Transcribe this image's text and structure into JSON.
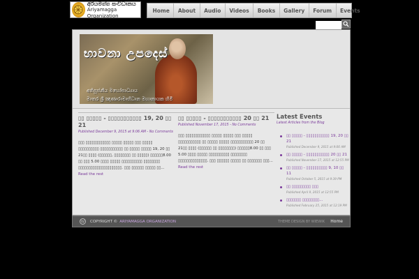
{
  "header": {
    "logo_line1": "අරියමග්ග සංවිධානය",
    "logo_line2": "Ariyamagga Organization",
    "nav": [
      "Home",
      "About",
      "Audio",
      "Videos",
      "Books",
      "Gallery",
      "Forum",
      "Events"
    ],
    "search_placeholder": ""
  },
  "banner": {
    "title": "භාවනා උපදෙස්",
    "subtitle_line1": "අතිපූජනීය මහෝපාධ්‍යාය",
    "subtitle_line2": "මාතර ශ්‍රී ඤාණාරාමාභිධාන මහානායක හිමි"
  },
  "posts": [
    {
      "title": "▯▯ ▯▯▯▯▯ - ▯▯▯▯▯▯▯▯▯▯▯ 19, 20 ▯▯ 21",
      "meta": "Published December 9, 2015 at 9:06 AM - No Comments",
      "body": "▯▯▯ ▯▯▯▯▯▯▯▯▯▯▯▯ ▯▯▯▯▯ ▯▯▯▯▯ ▯▯▯ ▯▯▯▯▯ ▯▯▯▯▯▯▯▯▯▯ ▯▯▯▯▯▯▯▯▯▯▯ ▯▯ ▯▯▯▯▯ ▯▯▯▯▯ 19, 20 ▯▯ 21▯▯ ▯▯▯▯ (▯▯▯▯▯▯, ▯▯▯▯▯▯▯▯ ▯▯ ▯▯▯▯▯) ▯▯▯▯▯▯8.00 ▯▯ ▯▯▯ 5.00 ▯▯▯▯ ▯▯▯▯▯ ▯▯▯▯▯▯▯▯▯▯ ▯▯▯▯▯▯▯▯ ▯▯▯▯▯▯▯▯▯▯▯▯▯▯▯▯▯▯▯▯▯. ▯▯▯ ▯▯▯▯▯▯ ▯▯▯▯▯ ▯▯...",
      "readmore": "Read the rest"
    },
    {
      "title": "▯▯ ▯▯▯▯▯ - ▯▯▯▯▯▯▯▯▯▯▯ 20 ▯▯ 21",
      "meta": "Published November 17, 2015 - No Comments",
      "body": "▯▯▯ ▯▯▯▯▯▯▯▯▯▯▯▯ ▯▯▯▯▯ ▯▯▯▯▯ ▯▯▯ ▯▯▯▯▯ ▯▯▯▯▯▯▯▯▯▯▯ ▯▯ ▯▯▯▯▯ ▯▯▯▯▯ ▯▯▯▯▯▯▯▯▯▯▯ 20 ▯▯ 21▯▯ ▯▯▯▯ (▯▯▯▯▯▯ ▯▯ ▯▯▯▯▯▯▯▯) ▯▯▯▯▯▯8.00 ▯▯ ▯▯▯ 5.00 ▯▯▯▯ ▯▯▯▯▯ ▯▯▯▯▯▯▯▯▯▯ ▯▯▯▯▯▯▯▯ ▯▯▯▯▯▯▯▯▯▯▯▯▯▯. ▯▯▯ ▯▯▯▯▯▯ ▯▯▯▯▯ ▯▯ ▯▯▯▯▯▯▯ ▯▯▯...",
      "readmore": "Read the rest"
    }
  ],
  "sidebar": {
    "title": "Latest Events",
    "subtitle": "Latest Articles from the Blog",
    "items": [
      {
        "title": "▯▯ ▯▯▯▯▯ - ▯▯▯▯▯▯▯▯▯▯▯ 19, 20 ▯▯ 21",
        "date": "Published December 9, 2015 at 9:06 AM"
      },
      {
        "title": "▯▯ ▯▯▯▯▯ - ▯▯▯▯▯▯▯▯▯▯▯ 20 ▯▯ 21",
        "date": "Published November 17, 2015 at 12:55 PM"
      },
      {
        "title": "▯▯ ▯▯▯▯▯ - ▯▯▯▯▯▯▯▯▯▯ 9, 10 ▯▯ 11",
        "date": "Published October 5, 2015 at 9:39 PM"
      },
      {
        "title": "▯▯ ▯▯▯▯▯▯▯▯▯ ▯▯▯",
        "date": "Published April 9, 2015 at 12:55 PM"
      },
      {
        "title": "▯▯▯▯▯▯▯ ▯▯▯▯▯▯▯▯...",
        "date": "Published February 25, 2015 at 12:19 PM"
      }
    ]
  },
  "footer": {
    "copyright": "COPYRIGHT ©",
    "org": "ARIYAMAGGA ORGANIZATION",
    "theme_credit": "THEME DESIGN BY WIEWIK",
    "home": "Home"
  }
}
